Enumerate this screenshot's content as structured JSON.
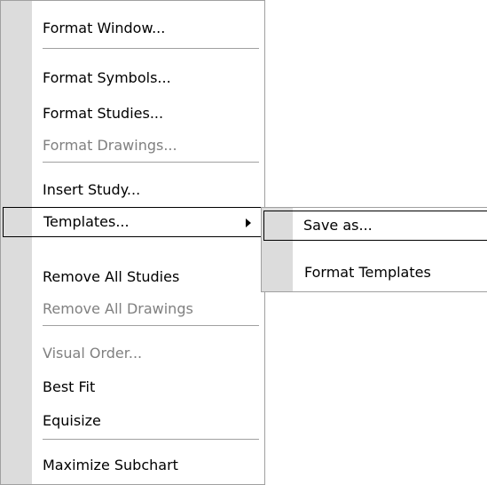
{
  "context_menu": {
    "items": [
      {
        "label": "Format Window..."
      },
      {
        "label": "Format Symbols..."
      },
      {
        "label": "Format Studies..."
      },
      {
        "label": "Format Drawings..."
      },
      {
        "label": "Insert Study..."
      },
      {
        "label": "Templates..."
      },
      {
        "label": "Remove All Studies"
      },
      {
        "label": "Remove All Drawings"
      },
      {
        "label": "Visual Order..."
      },
      {
        "label": "Best Fit"
      },
      {
        "label": "Equisize"
      },
      {
        "label": "Maximize Subchart"
      }
    ]
  },
  "templates_submenu": {
    "items": [
      {
        "label": "Save as..."
      },
      {
        "label": "Format Templates"
      }
    ]
  },
  "colors": {
    "icon_strip": "#dcdcdc",
    "disabled_text": "#808080",
    "border": "#a0a0a0"
  },
  "icons": [
    "submenu-arrow-icon"
  ]
}
